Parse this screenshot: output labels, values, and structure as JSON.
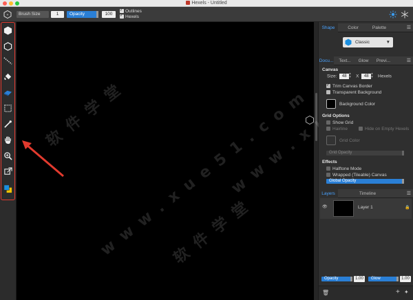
{
  "window": {
    "title": "Hexels - Untitled"
  },
  "toolbar": {
    "brush_size_label": "Brush Size",
    "brush_size_value": "1",
    "opacity_label": "Opacity",
    "opacity_value": "100",
    "outlines_label": "Outlines",
    "outlines_checked": true,
    "hexels_label": "Hexels",
    "hexels_checked": true
  },
  "tools": [
    {
      "name": "hexagon-tool",
      "icon": "hexagon-filled-icon"
    },
    {
      "name": "hexagon-outline-tool",
      "icon": "hexagon-outline-icon"
    },
    {
      "name": "line-tool",
      "icon": "dotted-line-icon"
    },
    {
      "name": "fill-tool",
      "icon": "paint-bucket-icon"
    },
    {
      "name": "eraser-tool",
      "icon": "eraser-icon"
    },
    {
      "name": "select-tool",
      "icon": "marquee-icon"
    },
    {
      "name": "eyedropper-tool",
      "icon": "eyedropper-icon"
    },
    {
      "name": "hand-tool",
      "icon": "hand-icon"
    },
    {
      "name": "zoom-tool",
      "icon": "magnifier-icon"
    },
    {
      "name": "transform-tool",
      "icon": "transform-icon"
    },
    {
      "name": "color-swatch",
      "icon": "color-swatch-icon",
      "foreground": "#1a8fe0",
      "background": "#f2c200"
    }
  ],
  "shape_panel": {
    "tabs": [
      "Shape",
      "Color",
      "Palette"
    ],
    "active_tab": "Shape",
    "selected_shape": "Classic"
  },
  "document_panel": {
    "tabs": [
      "Docu...",
      "Text...",
      "Glow",
      "Previ..."
    ],
    "active_tab": "Docu...",
    "canvas_title": "Canvas",
    "size_label": "Size:",
    "width": "48",
    "x_label": "X",
    "height": "48",
    "unit": "Hexels",
    "trim_canvas_border": "Trim Canvas Border",
    "trim_checked": true,
    "transparent_background": "Transparent Background",
    "transparent_checked": false,
    "background_color_label": "Background Color",
    "background_color": "#000000",
    "grid_title": "Grid Options",
    "show_grid": "Show Grid",
    "hairline": "Hairline",
    "hide_on_empty": "Hide on Empty Hexels",
    "grid_color": "Grid Color",
    "grid_opacity": "Grid Opacity",
    "effects_title": "Effects",
    "halftone_mode": "Halftone Mode",
    "wrapped_canvas": "Wrapped (Tileable) Canvas",
    "global_opacity": "Global Opacity"
  },
  "layers_panel": {
    "tabs": [
      "Layers",
      "Timeline"
    ],
    "active_tab": "Layers",
    "layers": [
      {
        "name": "Layer 1"
      }
    ],
    "opacity_label": "Opacity",
    "opacity_value": "1.00",
    "glow_label": "Glow",
    "glow_value": "1.00"
  },
  "colors": {
    "accent": "#2a7fd6",
    "highlight_frame": "#e23a2e"
  }
}
